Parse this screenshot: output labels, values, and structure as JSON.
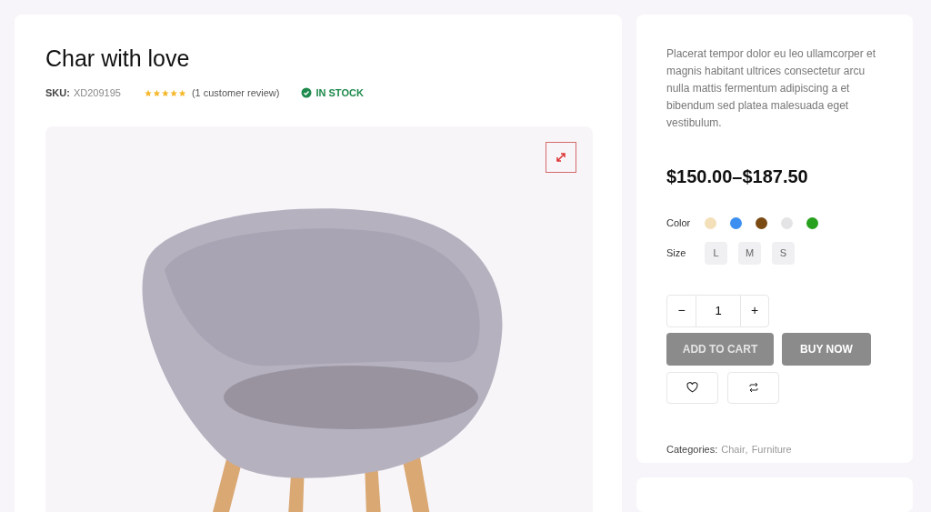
{
  "product": {
    "title": "Char with love",
    "sku_label": "SKU:",
    "sku": "XD209195",
    "stars": 5,
    "review_text": "(1 customer review)",
    "stock": "IN STOCK"
  },
  "description": "Placerat tempor dolor eu leo ullamcorper et magnis habitant ultrices consectetur arcu nulla mattis fermentum adipiscing a et bibendum sed platea malesuada eget vestibulum.",
  "price": "$150.00–$187.50",
  "color_label": "Color",
  "colors": [
    {
      "color": "#f3dfb8"
    },
    {
      "color": "#3b8ff0"
    },
    {
      "color": "#7a4a12"
    },
    {
      "color": "#e4e4e6"
    },
    {
      "color": "#27a11e"
    }
  ],
  "size_label": "Size",
  "sizes": [
    "L",
    "M",
    "S"
  ],
  "quantity": {
    "minus": "−",
    "value": "1",
    "plus": "+"
  },
  "buttons": [
    "ADD TO CART",
    "BUY NOW"
  ],
  "categories": {
    "label": "Categories:",
    "separator": ",",
    "items": [
      "Chair",
      "Furniture"
    ]
  }
}
